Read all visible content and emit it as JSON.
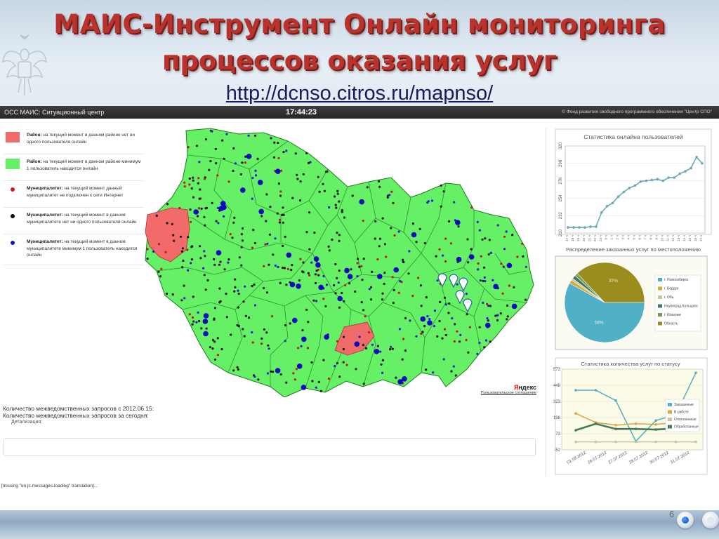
{
  "slide": {
    "title_line1": "МАИС-Инструмент Онлайн мониторинга",
    "title_line2": "процессов оказания услуг",
    "url": "http://dcnso.citros.ru/mapnso/",
    "page_number": "6"
  },
  "app": {
    "title": "ОСС МАИС: Ситуационный центр",
    "clock": "17:44:23",
    "copyright": "© Фонд развития свободного программного обеспечения \"Центр СПО\""
  },
  "legend": {
    "items": [
      {
        "kind": "Район:",
        "text": "на текущий момент в данном районе нет ни одного пользователя онлайн",
        "color": "#f26b6b",
        "shape": "square"
      },
      {
        "kind": "Район:",
        "text": "на текущий момент в данном районе минимум 1 пользователь находится онлайн",
        "color": "#66f066",
        "shape": "square"
      },
      {
        "kind": "Муниципалитет:",
        "text": "на текущий момент данный муниципалитет не подключен к сети Интернет",
        "color": "#d11a1a",
        "shape": "dot"
      },
      {
        "kind": "Муниципалитет:",
        "text": "на текущий момент в данном муниципалитете нет ни одного пользователя онлайн",
        "color": "#111111",
        "shape": "dot"
      },
      {
        "kind": "Муниципалитет:",
        "text": "на текущий момент в данном муниципалитете минимум 1 пользователь находится онлайн",
        "color": "#1515c8",
        "shape": "dot"
      }
    ]
  },
  "map": {
    "attribution": "Яндекс",
    "user_agreement": "Пользовательское соглашение",
    "region_color": "#66f066",
    "offline_region_color": "#f26b6b"
  },
  "stats": {
    "interdept_since": "Количество межведомственных запросов с 2012.06.15:",
    "interdept_today": "Количество межведомственных запросов за сегодня:",
    "detail": "Детализация:",
    "missing_translation": "[missing \"en.js.messages.loading\" translation]..."
  },
  "panels": {
    "online_title": "Статистика онлайна пользователей",
    "distribution_title": "Распределение заказанных услуг по местоположению",
    "status_title": "Статистика количества услуг по статусу"
  },
  "chart_data": [
    {
      "type": "line",
      "title": "Статистика онлайна пользователей",
      "y_ticks": [
        "210",
        "232",
        "254",
        "276",
        "298",
        "320"
      ],
      "ylim": [
        210,
        320
      ],
      "x_labels": [
        "17 ч",
        "18 ч",
        "19 ч",
        "20 ч",
        "21 ч",
        "22 ч",
        "23 ч",
        "0 ч",
        "1 ч",
        "2 ч",
        "3 ч",
        "4 ч",
        "5 ч",
        "6 ч",
        "7 ч",
        "8 ч",
        "9 ч",
        "10 ч",
        "11 ч",
        "12 ч",
        "13 ч",
        "14 ч",
        "15 ч",
        "16 ч",
        "17 ч"
      ],
      "series": [
        {
          "color": "#6aaab8",
          "values": [
            217,
            217,
            217,
            217,
            218,
            218,
            236,
            244,
            248,
            256,
            262,
            267,
            270,
            275,
            276,
            277,
            278,
            276,
            280,
            280,
            285,
            288,
            292,
            306,
            298
          ]
        }
      ]
    },
    {
      "type": "pie",
      "title": "Распределение заказанных услуг по местоположению",
      "slices": [
        {
          "label": "г. Новосибирск",
          "value": 58,
          "color": "#4fb0c6",
          "text": "58%"
        },
        {
          "label": "г. Бердск",
          "value": 1.5,
          "color": "#d9a93c",
          "text": ""
        },
        {
          "label": "г. Обь",
          "value": 0.8,
          "color": "#c9c29a",
          "text": ""
        },
        {
          "label": "Наукоград Кольцово",
          "value": 1.5,
          "color": "#3f7b5a",
          "text": ""
        },
        {
          "label": "г. Искитим",
          "value": 1.2,
          "color": "#7a9a55",
          "text": ""
        },
        {
          "label": "Область",
          "value": 37,
          "color": "#9a8d1e",
          "text": "37%"
        }
      ]
    },
    {
      "type": "line",
      "title": "Статистика количества услуг по статусу",
      "y_ticks": [
        "-52",
        "73",
        "198",
        "323",
        "448",
        "573"
      ],
      "ylim": [
        -52,
        573
      ],
      "categories": [
        "01.08.2012",
        "26.07.2012",
        "27.07.2012",
        "28.07.2012",
        "30.07.2012",
        "31.07.2012"
      ],
      "x_positions": [
        0,
        1,
        2,
        3,
        4,
        5,
        6
      ],
      "series": [
        {
          "name": "Заказанные",
          "color": "#4fb0c6",
          "values": [
            410,
            410,
            330,
            15,
            175,
            220,
            545
          ]
        },
        {
          "name": "В работе",
          "color": "#e0a33c",
          "values": [
            230,
            160,
            140,
            150,
            145,
            160,
            170
          ]
        },
        {
          "name": "Отклонённые",
          "color": "#c9c29a",
          "values": [
            10,
            10,
            10,
            10,
            10,
            10,
            10
          ]
        },
        {
          "name": "Обработанные",
          "color": "#3f7b5a",
          "values": [
            100,
            150,
            110,
            110,
            105,
            115,
            145
          ]
        }
      ]
    }
  ]
}
